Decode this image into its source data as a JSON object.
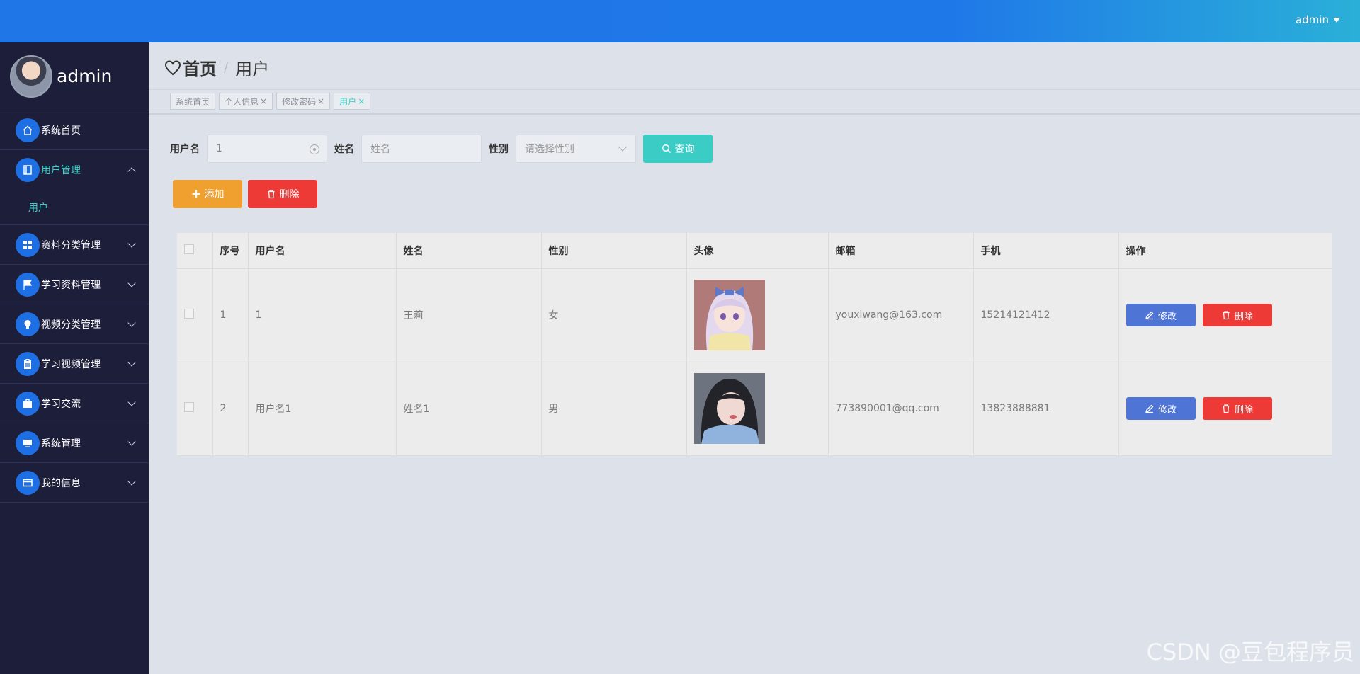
{
  "header": {
    "user": "admin"
  },
  "sidebar": {
    "profile_name": "admin",
    "items": [
      {
        "label": "系统首页",
        "icon": "home-icon"
      },
      {
        "label": "用户管理",
        "icon": "book-icon",
        "open": true,
        "children": [
          {
            "label": "用户"
          }
        ]
      },
      {
        "label": "资料分类管理",
        "icon": "grid-icon"
      },
      {
        "label": "学习资料管理",
        "icon": "flag-icon"
      },
      {
        "label": "视频分类管理",
        "icon": "bulb-icon"
      },
      {
        "label": "学习视频管理",
        "icon": "clipboard-icon"
      },
      {
        "label": "学习交流",
        "icon": "briefcase-icon"
      },
      {
        "label": "系统管理",
        "icon": "monitor-icon"
      },
      {
        "label": "我的信息",
        "icon": "card-icon"
      }
    ]
  },
  "breadcrumb": {
    "home": "首页",
    "sep": "/",
    "current": "用户"
  },
  "tabs": [
    "系统首页",
    "个人信息",
    "修改密码",
    "用户"
  ],
  "search": {
    "username_label": "用户名",
    "username_value": "1",
    "name_label": "姓名",
    "name_placeholder": "姓名",
    "gender_label": "性别",
    "gender_placeholder": "请选择性别",
    "query_label": "查询"
  },
  "actions": {
    "add": "添加",
    "delete": "删除"
  },
  "table": {
    "columns": [
      "序号",
      "用户名",
      "姓名",
      "性别",
      "头像",
      "邮箱",
      "手机",
      "操作"
    ],
    "rows": [
      {
        "index": "1",
        "username": "1",
        "name": "王莉",
        "gender": "女",
        "email": "youxiwang@163.com",
        "phone": "15214121412"
      },
      {
        "index": "2",
        "username": "用户名1",
        "name": "姓名1",
        "gender": "男",
        "email": "773890001@qq.com",
        "phone": "13823888881"
      }
    ],
    "edit_label": "修改",
    "delete_label": "删除"
  },
  "watermark": "CSDN @豆包程序员"
}
